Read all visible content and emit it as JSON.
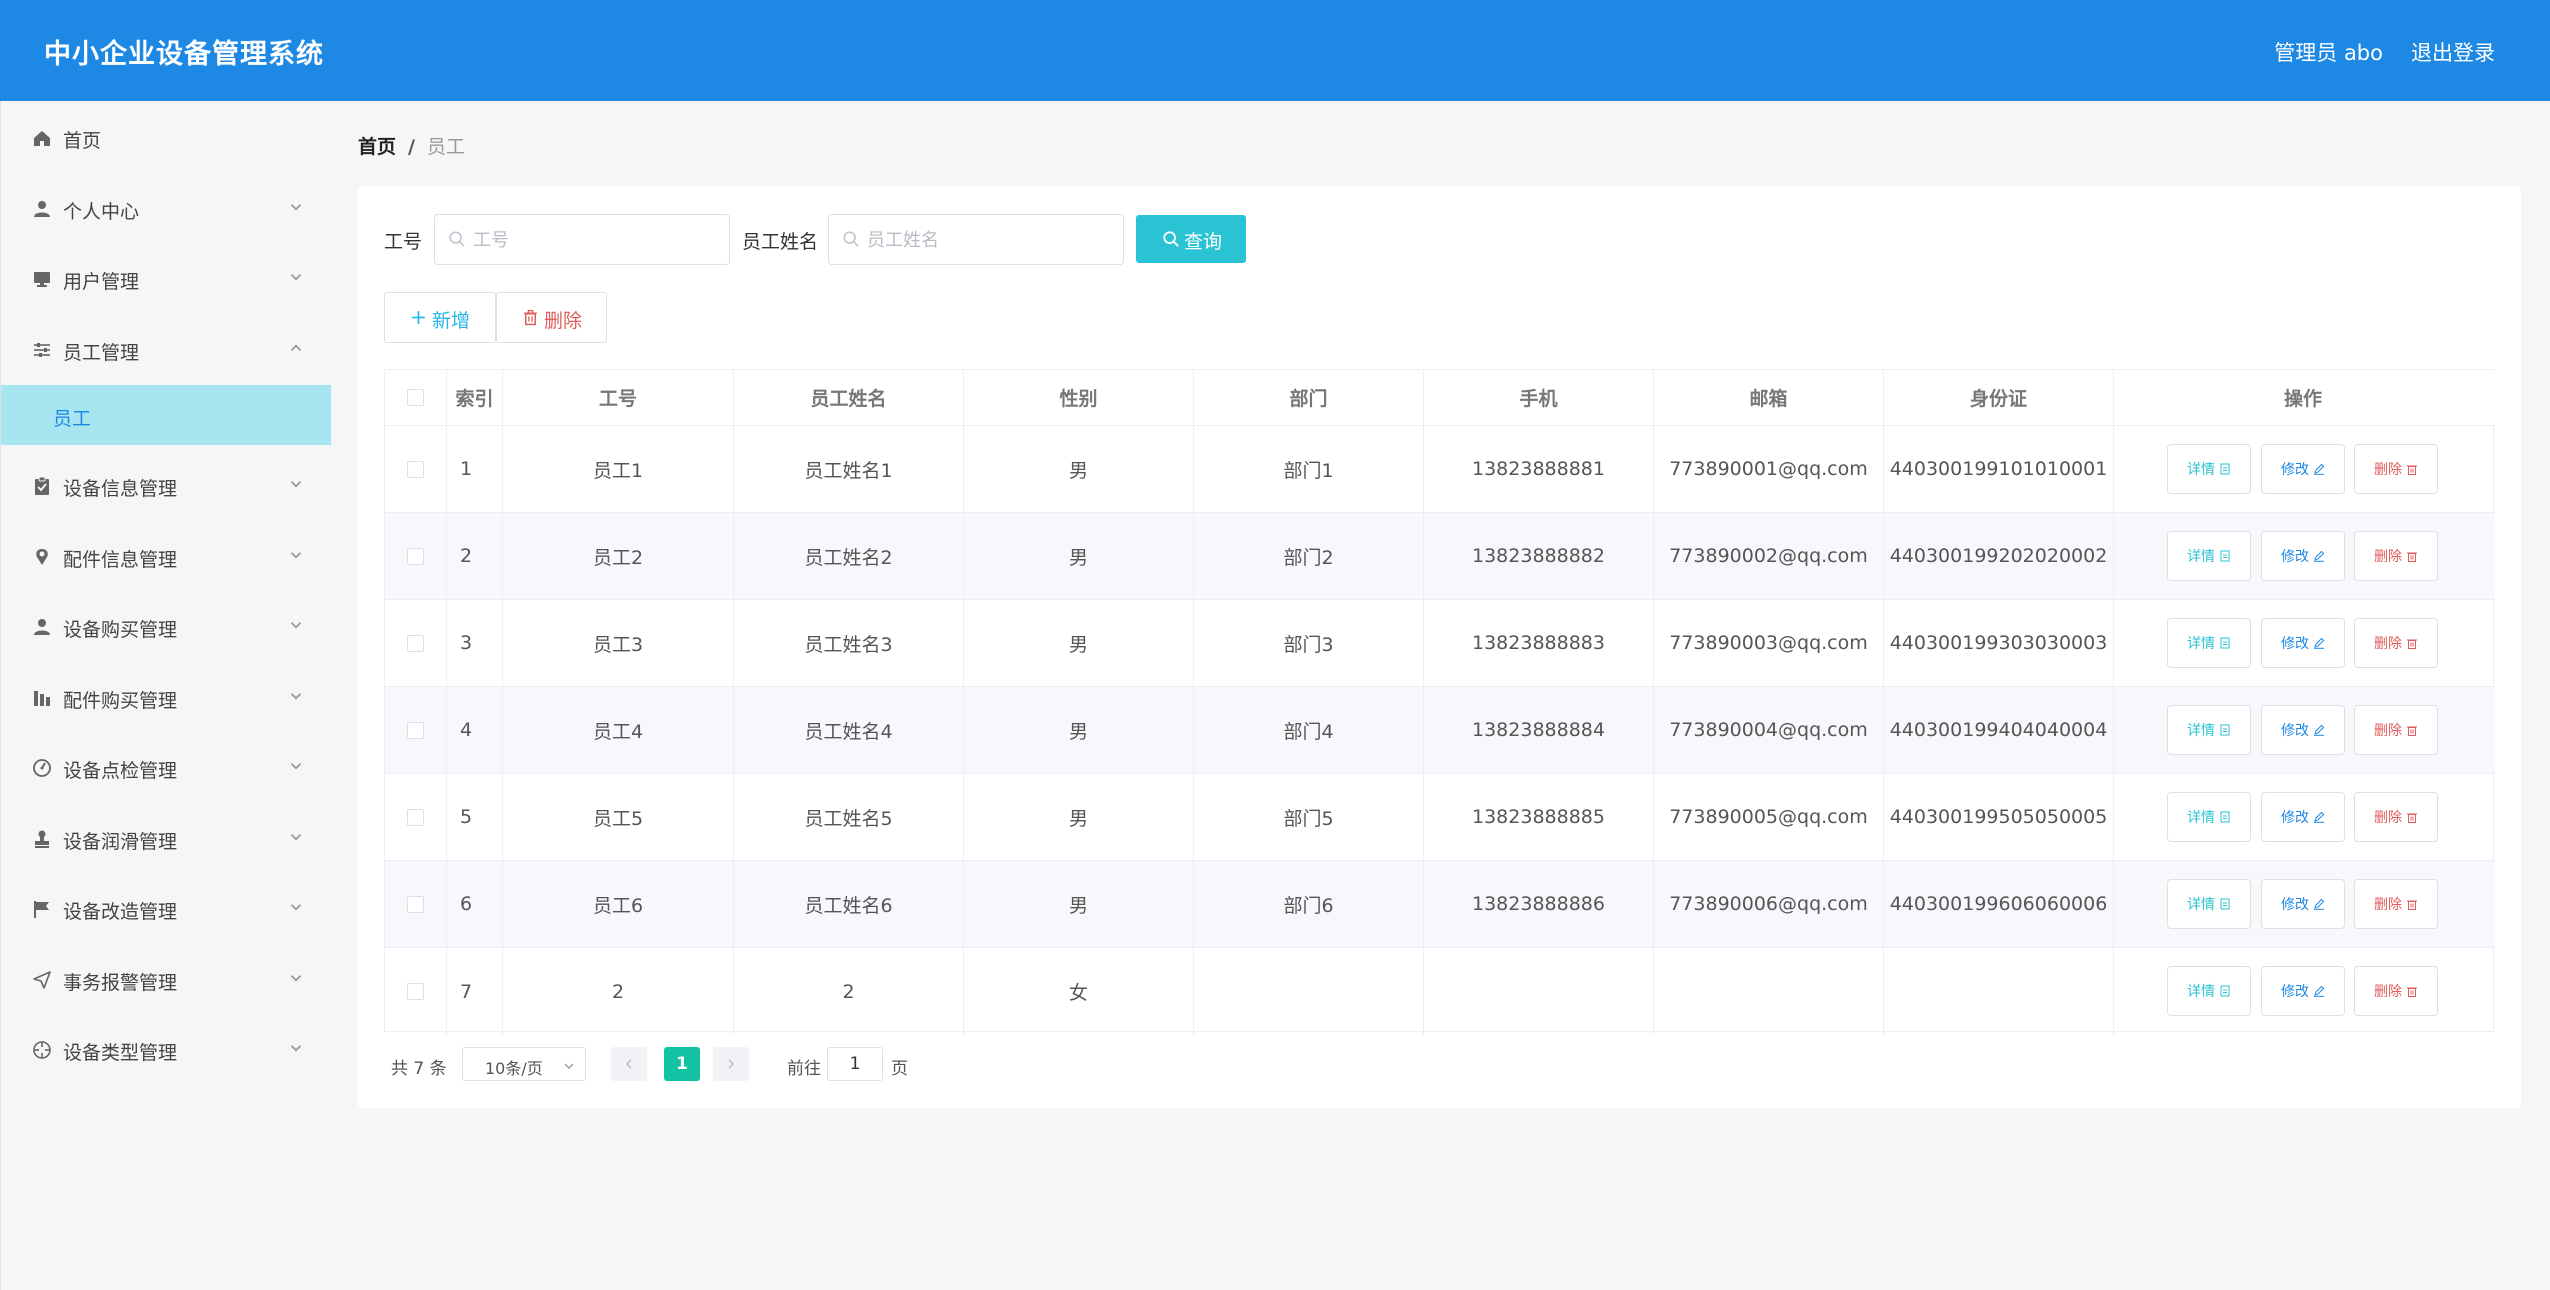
{
  "header": {
    "title": "中小企业设备管理系统",
    "user": "管理员 abo",
    "logout": "退出登录"
  },
  "sidebar": {
    "items": [
      {
        "label": "首页",
        "icon": "home-icon"
      },
      {
        "label": "个人中心",
        "icon": "user-icon"
      },
      {
        "label": "用户管理",
        "icon": "monitor-icon"
      },
      {
        "label": "员工管理",
        "icon": "sliders-icon",
        "expanded": true
      },
      {
        "label": "设备信息管理",
        "icon": "clipboard-icon"
      },
      {
        "label": "配件信息管理",
        "icon": "pin-icon"
      },
      {
        "label": "设备购买管理",
        "icon": "user-icon"
      },
      {
        "label": "配件购买管理",
        "icon": "chart-icon"
      },
      {
        "label": "设备点检管理",
        "icon": "gauge-icon"
      },
      {
        "label": "设备润滑管理",
        "icon": "stamp-icon"
      },
      {
        "label": "设备改造管理",
        "icon": "flag-icon"
      },
      {
        "label": "事务报警管理",
        "icon": "send-icon"
      },
      {
        "label": "设备类型管理",
        "icon": "target-icon"
      }
    ],
    "subitem": "员工"
  },
  "breadcrumb": {
    "home": "首页",
    "separator": "/",
    "current": "员工"
  },
  "search": {
    "id_label": "工号",
    "id_placeholder": "工号",
    "name_label": "员工姓名",
    "name_placeholder": "员工姓名",
    "button": "查询"
  },
  "actions": {
    "add": "新增",
    "delete": "删除"
  },
  "table": {
    "columns": [
      "索引",
      "工号",
      "员工姓名",
      "性别",
      "部门",
      "手机",
      "邮箱",
      "身份证",
      "操作"
    ],
    "rows": [
      {
        "index": "1",
        "id": "员工1",
        "name": "员工姓名1",
        "gender": "男",
        "dept": "部门1",
        "phone": "13823888881",
        "email": "773890001@qq.com",
        "idcard": "440300199101010001"
      },
      {
        "index": "2",
        "id": "员工2",
        "name": "员工姓名2",
        "gender": "男",
        "dept": "部门2",
        "phone": "13823888882",
        "email": "773890002@qq.com",
        "idcard": "440300199202020002"
      },
      {
        "index": "3",
        "id": "员工3",
        "name": "员工姓名3",
        "gender": "男",
        "dept": "部门3",
        "phone": "13823888883",
        "email": "773890003@qq.com",
        "idcard": "440300199303030003"
      },
      {
        "index": "4",
        "id": "员工4",
        "name": "员工姓名4",
        "gender": "男",
        "dept": "部门4",
        "phone": "13823888884",
        "email": "773890004@qq.com",
        "idcard": "440300199404040004"
      },
      {
        "index": "5",
        "id": "员工5",
        "name": "员工姓名5",
        "gender": "男",
        "dept": "部门5",
        "phone": "13823888885",
        "email": "773890005@qq.com",
        "idcard": "440300199505050005"
      },
      {
        "index": "6",
        "id": "员工6",
        "name": "员工姓名6",
        "gender": "男",
        "dept": "部门6",
        "phone": "13823888886",
        "email": "773890006@qq.com",
        "idcard": "440300199606060006"
      },
      {
        "index": "7",
        "id": "2",
        "name": "2",
        "gender": "女",
        "dept": "",
        "phone": "",
        "email": "",
        "idcard": ""
      }
    ],
    "ops": {
      "detail": "详情",
      "edit": "修改",
      "delete": "删除"
    }
  },
  "pager": {
    "total": "共 7 条",
    "size": "10条/页",
    "current": "1",
    "goto": "前往",
    "goto_value": "1",
    "unit": "页"
  },
  "colors": {
    "header": "#1e88e5",
    "search_button": "#29c3d4",
    "active_submenu": "#a7e6f0",
    "active_page": "#13c2a3",
    "danger": "#e05b5b"
  }
}
